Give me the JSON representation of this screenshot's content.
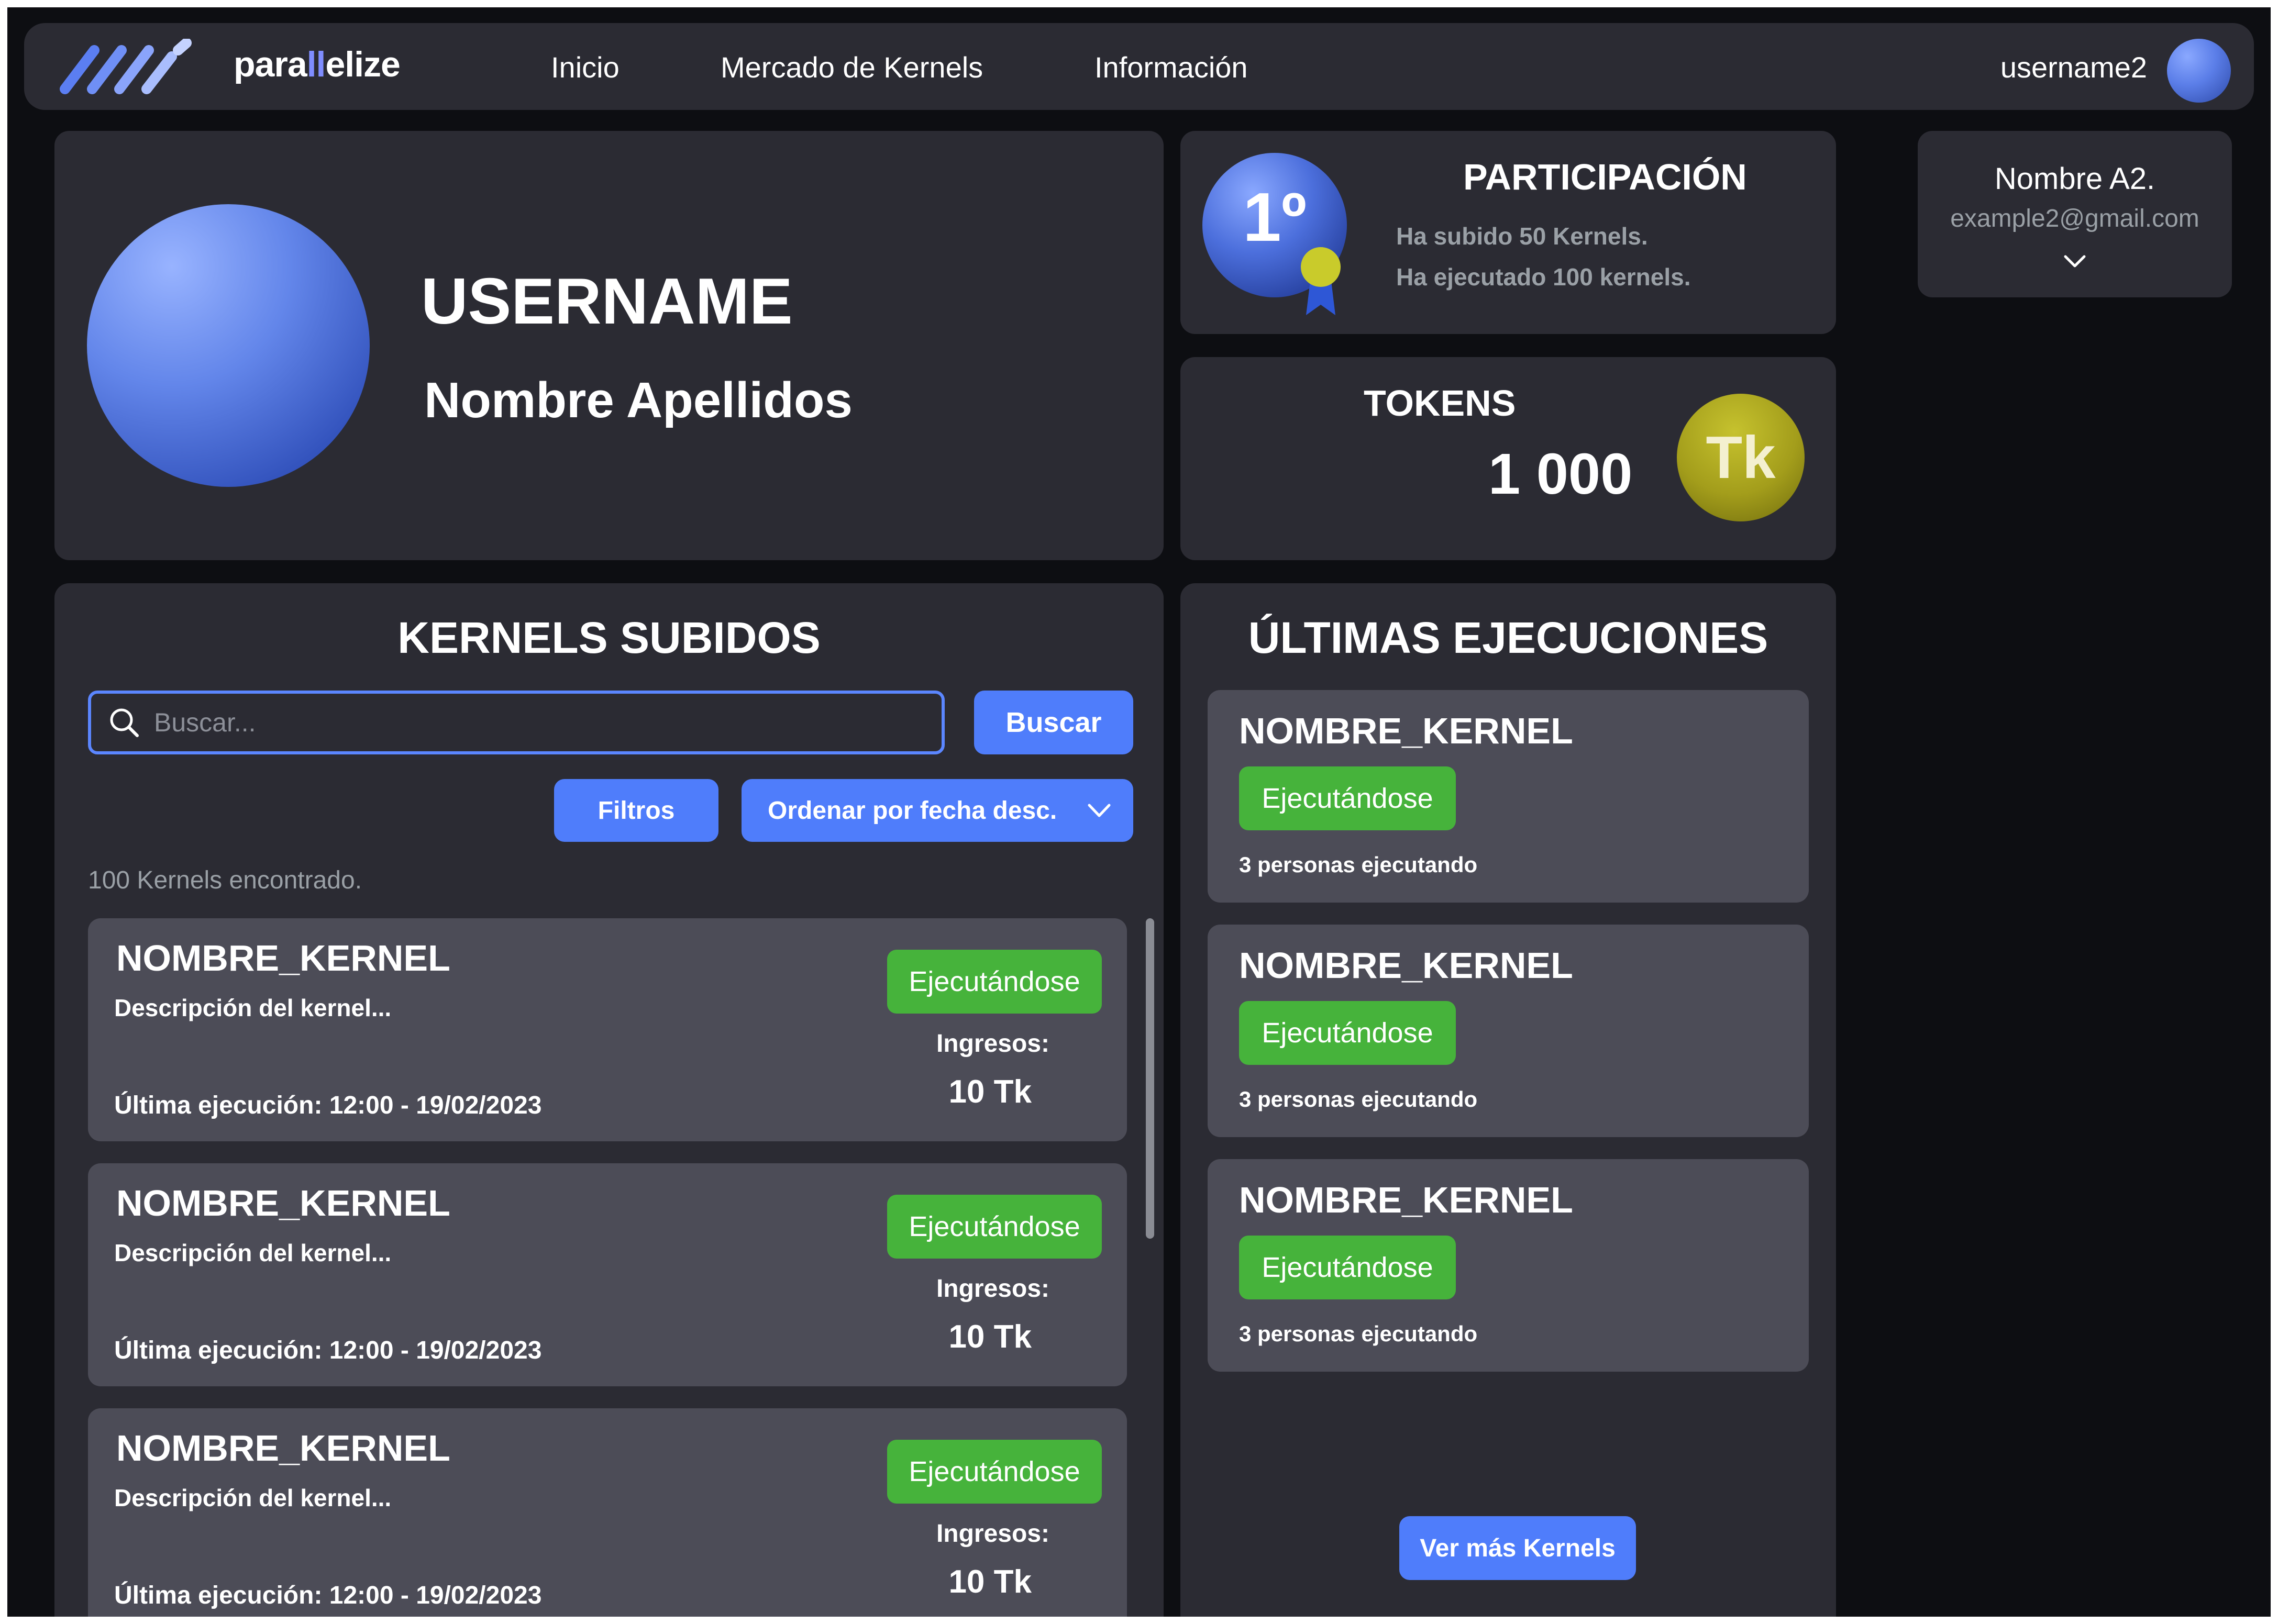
{
  "nav": {
    "brand_prefix": "para",
    "brand_accent": "ll",
    "brand_suffix": "elize",
    "links": [
      "Inicio",
      "Mercado de Kernels",
      "Información"
    ],
    "username": "username2"
  },
  "profile": {
    "username": "USERNAME",
    "full_name": "Nombre Apellidos"
  },
  "participation": {
    "rank": "1º",
    "title": "PARTICIPACIÓN",
    "uploaded_text": "Ha subido 50 Kernels.",
    "executed_text": "Ha ejecutado 100 kernels."
  },
  "tokens": {
    "title": "TOKENS",
    "value": "1 000",
    "coin_label": "Tk"
  },
  "account": {
    "name": "Nombre A2.",
    "email": "example2@gmail.com"
  },
  "kernels_uploaded": {
    "title": "KERNELS SUBIDOS",
    "search_placeholder": "Buscar...",
    "search_button": "Buscar",
    "filters_button": "Filtros",
    "sort_selected": "Ordenar por fecha desc.",
    "result_count": "100 Kernels encontrado.",
    "items": [
      {
        "name": "NOMBRE_KERNEL",
        "description": "Descripción del kernel...",
        "status": "Ejecutándose",
        "income_label": "Ingresos:",
        "income": "10 Tk",
        "last_run": "Última ejecución: 12:00 - 19/02/2023"
      },
      {
        "name": "NOMBRE_KERNEL",
        "description": "Descripción del kernel...",
        "status": "Ejecutándose",
        "income_label": "Ingresos:",
        "income": "10 Tk",
        "last_run": "Última ejecución: 12:00 - 19/02/2023"
      },
      {
        "name": "NOMBRE_KERNEL",
        "description": "Descripción del kernel...",
        "status": "Ejecutándose",
        "income_label": "Ingresos:",
        "income": "10 Tk",
        "last_run": "Última ejecución: 12:00 - 19/02/2023"
      }
    ]
  },
  "recent_executions": {
    "title": "ÚLTIMAS EJECUCIONES",
    "items": [
      {
        "name": "NOMBRE_KERNEL",
        "status": "Ejecutándose",
        "people": "3 personas ejecutando"
      },
      {
        "name": "NOMBRE_KERNEL",
        "status": "Ejecutándose",
        "people": "3 personas ejecutando"
      },
      {
        "name": "NOMBRE_KERNEL",
        "status": "Ejecutándose",
        "people": "3 personas ejecutando"
      }
    ],
    "more_button": "Ver más Kernels"
  },
  "colors": {
    "background": "#0d0e12",
    "panel": "#2b2b33",
    "card": "#4c4c57",
    "accent_blue": "#4f7dfb",
    "status_green": "#46b33b",
    "muted_text": "#9aa0a6",
    "coin_gold": "#a39d1b"
  },
  "icons": [
    "logo-stripes-icon",
    "search-icon",
    "chevron-down-icon",
    "rank-medal-icon",
    "token-coin-icon"
  ]
}
